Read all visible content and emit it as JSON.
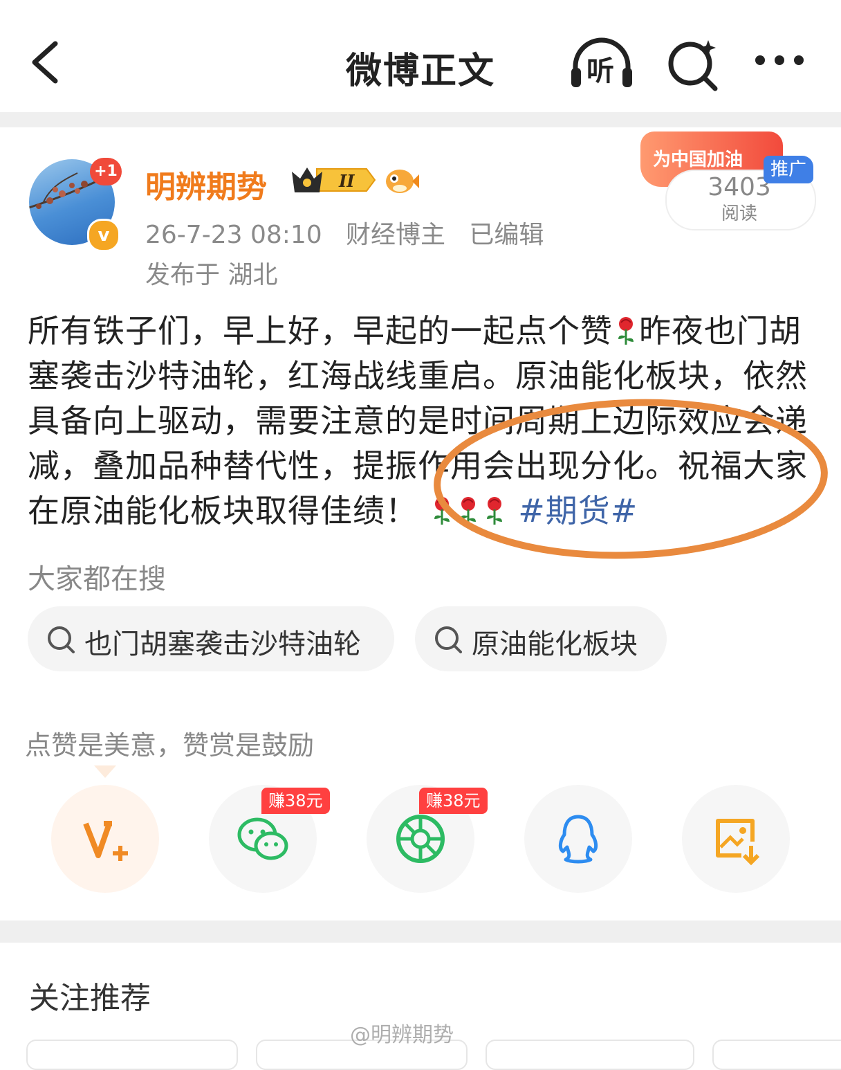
{
  "topbar": {
    "title": "微博正文",
    "listen_label": "听"
  },
  "post": {
    "author": "明辨期势",
    "avatar_badge": "+1",
    "verified_mark": "v",
    "level_badge": "II",
    "date": "26-7-23 08:10",
    "category": "财经博主",
    "edited": "已编辑",
    "location": "发布于 湖北",
    "text": {
      "part1": "所有铁子们，早上好，早起的一起点个赞",
      "part2": "昨夜也门胡塞袭击沙特油轮，红海战线重启。原油能化板块，依然具备向上驱动，需要注意的是时间周期上边际效应会递减，叠加品种替代性，提振作用会出现分化。祝福大家在原油能化板块取得佳绩！",
      "hashtag": "#期货#"
    }
  },
  "promo": {
    "banner_text": "为中国加油",
    "tag": "推广",
    "read_count": "3403",
    "read_label": "阅读"
  },
  "search": {
    "heading": "大家都在搜",
    "chips": [
      "也门胡塞袭击沙特油轮",
      "原油能化板块"
    ]
  },
  "share": {
    "encourage": "点赞是美意，赞赏是鼓励",
    "earn_badge_1": "赚38元",
    "earn_badge_2": "赚38元"
  },
  "recommend": {
    "title": "关注推荐"
  },
  "watermark": "@明辨期势",
  "colors": {
    "author": "#f07b1c",
    "hashtag": "#3f65a8",
    "wechat": "#2dbb63",
    "qq": "#2d8cf0",
    "save": "#f5a623",
    "annotation_circle": "#e98a3e"
  }
}
